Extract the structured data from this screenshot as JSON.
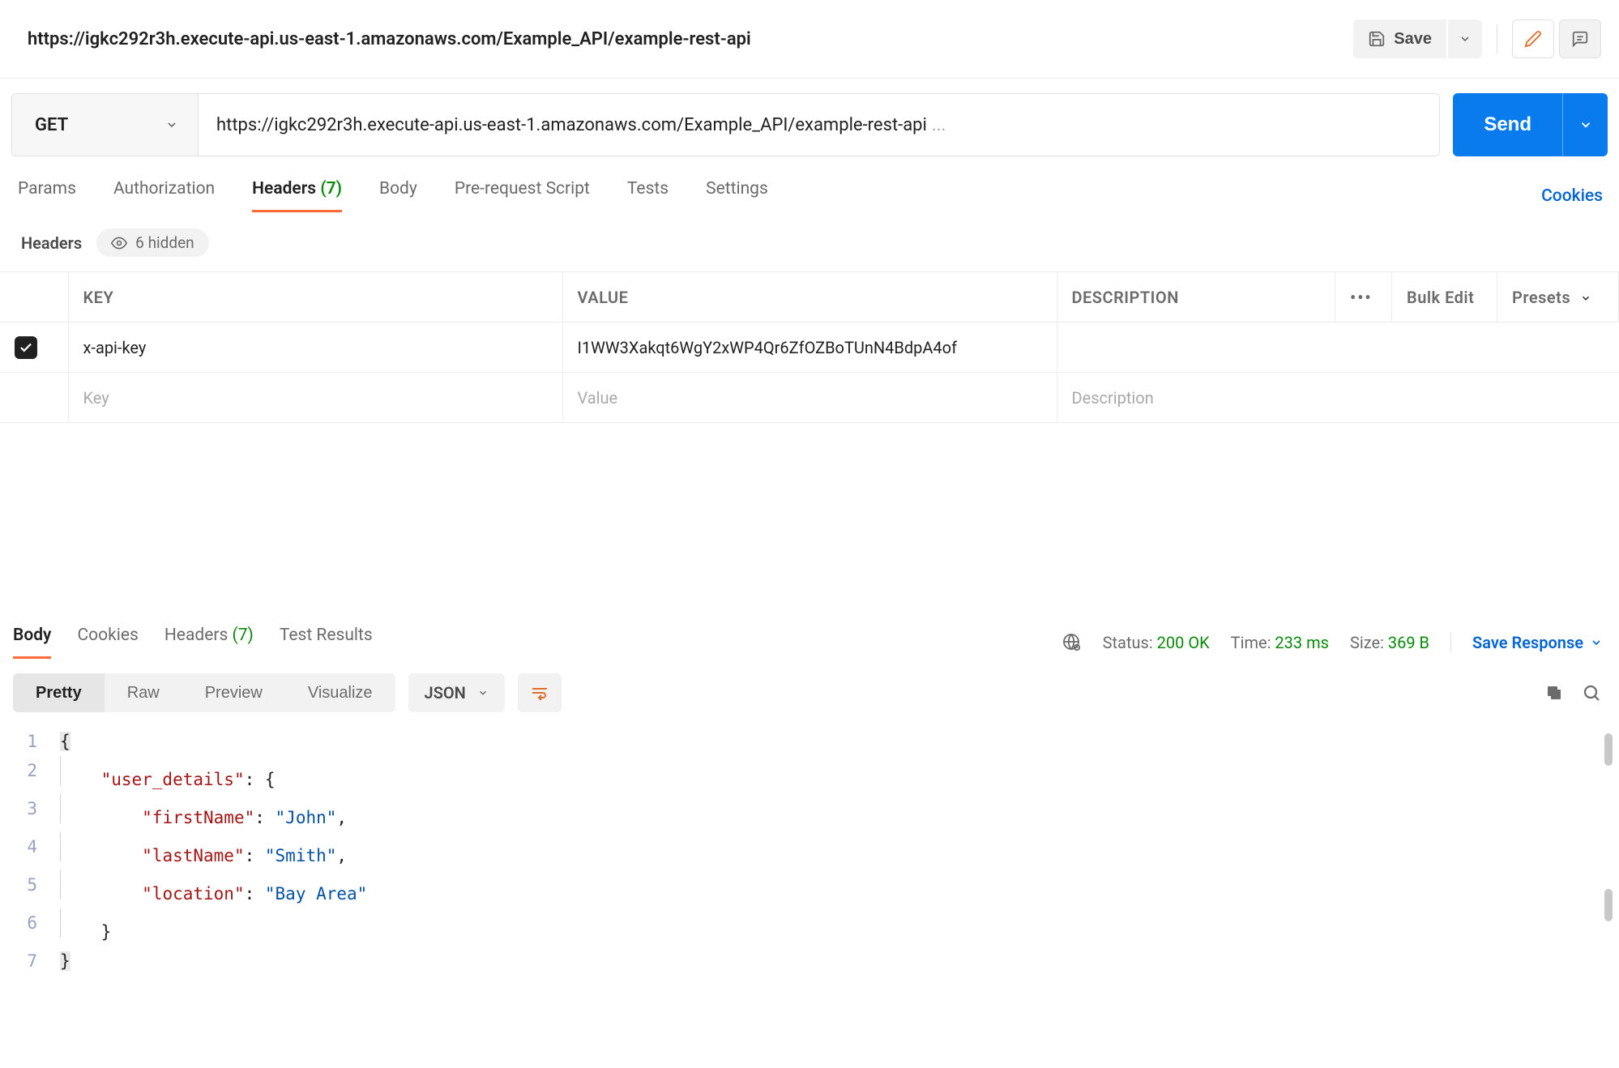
{
  "topbar": {
    "title": "https://igkc292r3h.execute-api.us-east-1.amazonaws.com/Example_API/example-rest-api",
    "save_label": "Save"
  },
  "request": {
    "method": "GET",
    "url": "https://igkc292r3h.execute-api.us-east-1.amazonaws.com/Example_API/example-rest-api",
    "url_ellipsis": "...",
    "send_label": "Send"
  },
  "request_tabs": {
    "params": "Params",
    "authorization": "Authorization",
    "headers": "Headers",
    "headers_count": "(7)",
    "body": "Body",
    "prerequest": "Pre-request Script",
    "tests": "Tests",
    "settings": "Settings",
    "cookies_link": "Cookies"
  },
  "headers_sub": {
    "label": "Headers",
    "hidden": "6 hidden"
  },
  "headers_table": {
    "columns": {
      "key": "KEY",
      "value": "VALUE",
      "description": "DESCRIPTION",
      "bulk": "Bulk Edit",
      "presets": "Presets"
    },
    "rows": [
      {
        "checked": true,
        "key": "x-api-key",
        "value": "I1WW3Xakqt6WgY2xWP4Qr6ZfOZBoTUnN4BdpA4of",
        "description": ""
      }
    ],
    "placeholders": {
      "key": "Key",
      "value": "Value",
      "description": "Description"
    }
  },
  "response_tabs": {
    "body": "Body",
    "cookies": "Cookies",
    "headers": "Headers",
    "headers_count": "(7)",
    "test_results": "Test Results"
  },
  "response_meta": {
    "status_label": "Status:",
    "status_value": "200 OK",
    "time_label": "Time:",
    "time_value": "233 ms",
    "size_label": "Size:",
    "size_value": "369 B",
    "save_response": "Save Response"
  },
  "body_toolbar": {
    "pretty": "Pretty",
    "raw": "Raw",
    "preview": "Preview",
    "visualize": "Visualize",
    "format": "JSON"
  },
  "response_body_json": {
    "user_details": {
      "firstName": "John",
      "lastName": "Smith",
      "location": "Bay Area"
    }
  },
  "code_display": {
    "lines": [
      {
        "n": "1",
        "indent": 0,
        "tokens": [
          {
            "cls": "tok-brace-hl",
            "t": "{"
          }
        ]
      },
      {
        "n": "2",
        "indent": 1,
        "tokens": [
          {
            "cls": "tok-key",
            "t": "\"user_details\""
          },
          {
            "cls": "tok-punc",
            "t": ": {"
          }
        ]
      },
      {
        "n": "3",
        "indent": 2,
        "tokens": [
          {
            "cls": "tok-key",
            "t": "\"firstName\""
          },
          {
            "cls": "tok-punc",
            "t": ": "
          },
          {
            "cls": "tok-str",
            "t": "\"John\""
          },
          {
            "cls": "tok-punc",
            "t": ","
          }
        ]
      },
      {
        "n": "4",
        "indent": 2,
        "tokens": [
          {
            "cls": "tok-key",
            "t": "\"lastName\""
          },
          {
            "cls": "tok-punc",
            "t": ": "
          },
          {
            "cls": "tok-str",
            "t": "\"Smith\""
          },
          {
            "cls": "tok-punc",
            "t": ","
          }
        ]
      },
      {
        "n": "5",
        "indent": 2,
        "tokens": [
          {
            "cls": "tok-key",
            "t": "\"location\""
          },
          {
            "cls": "tok-punc",
            "t": ": "
          },
          {
            "cls": "tok-str",
            "t": "\"Bay Area\""
          }
        ]
      },
      {
        "n": "6",
        "indent": 1,
        "tokens": [
          {
            "cls": "tok-punc",
            "t": "}"
          }
        ]
      },
      {
        "n": "7",
        "indent": 0,
        "tokens": [
          {
            "cls": "tok-brace-hl",
            "t": "}"
          }
        ]
      }
    ]
  }
}
